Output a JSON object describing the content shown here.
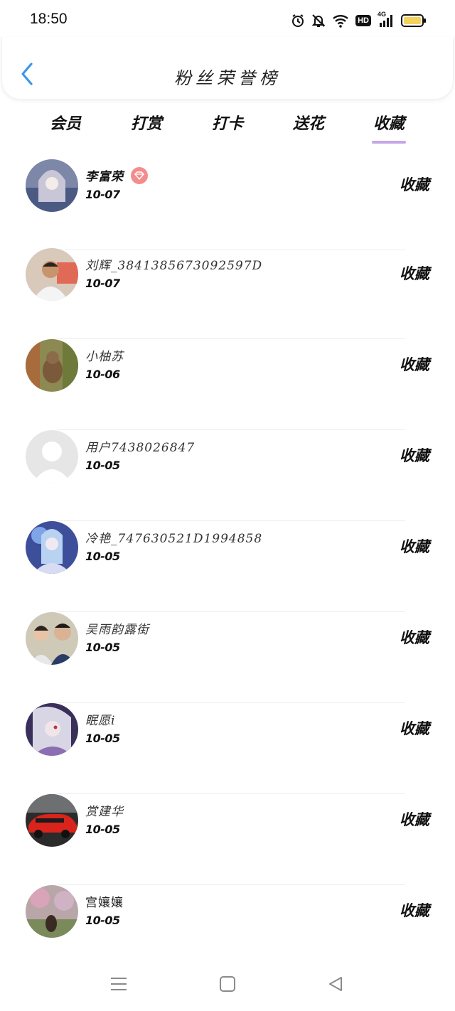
{
  "status_bar": {
    "time": "18:50",
    "icons": [
      "alarm-icon",
      "bell-off-icon",
      "wifi-icon",
      "hd-icon",
      "signal-4g-icon",
      "battery-icon"
    ],
    "hd_label": "HD",
    "network_label": "4G"
  },
  "header": {
    "title": "粉丝荣誉榜",
    "back_icon": "chevron-left-icon",
    "accent_color": "#3a97e8"
  },
  "tabs": {
    "items": [
      {
        "label": "会员"
      },
      {
        "label": "打赏"
      },
      {
        "label": "打卡"
      },
      {
        "label": "送花"
      },
      {
        "label": "收藏"
      }
    ],
    "active_index": 4,
    "indicator_color": "#c5a6e6"
  },
  "fans": [
    {
      "name": "李富荣",
      "date": "10-07",
      "action": "收藏",
      "vip": true
    },
    {
      "name": "刘辉_3841385673092597D",
      "date": "10-07",
      "action": "收藏"
    },
    {
      "name": "小柚苏",
      "date": "10-06",
      "action": "收藏"
    },
    {
      "name": "用户7438026847",
      "date": "10-05",
      "action": "收藏"
    },
    {
      "name": "冷艳_747630521D1994858",
      "date": "10-05",
      "action": "收藏"
    },
    {
      "name": "吴雨韵露街",
      "date": "10-05",
      "action": "收藏"
    },
    {
      "name": "眠愿i",
      "date": "10-05",
      "action": "收藏"
    },
    {
      "name": "赏建华",
      "date": "10-05",
      "action": "收藏"
    },
    {
      "name": "宫孃孃",
      "date": "10-05",
      "action": "收藏"
    }
  ],
  "nav_bar": {
    "buttons": [
      "menu-icon",
      "home-square-icon",
      "back-triangle-icon"
    ]
  }
}
